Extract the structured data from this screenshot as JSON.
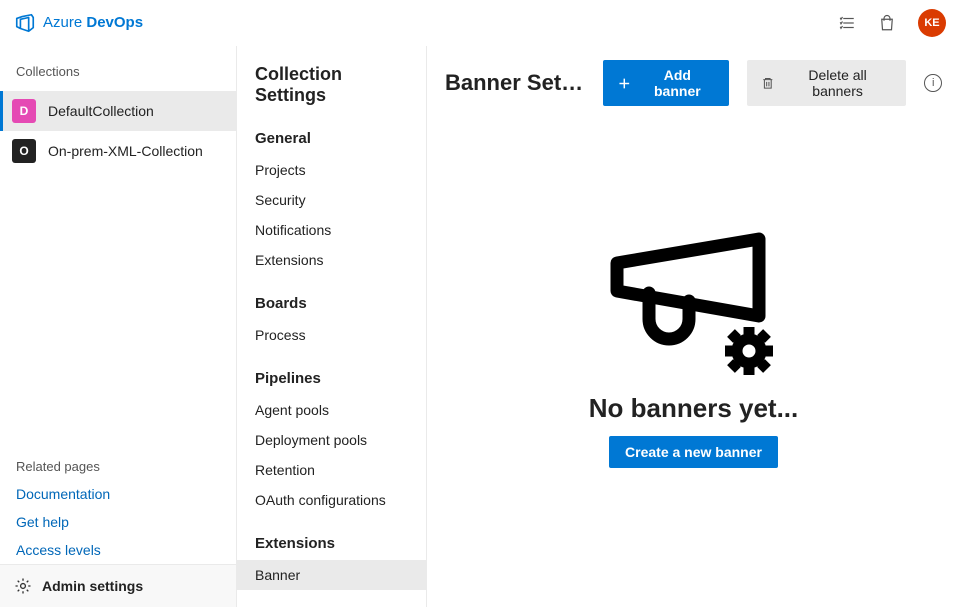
{
  "header": {
    "brand_prefix": "Azure ",
    "brand_bold": "DevOps",
    "avatar_initials": "KE"
  },
  "collections": {
    "title": "Collections",
    "items": [
      {
        "initial": "D",
        "label": "DefaultCollection",
        "color": "pink",
        "selected": true
      },
      {
        "initial": "O",
        "label": "On-prem-XML-Collection",
        "color": "dark",
        "selected": false
      }
    ],
    "related_title": "Related pages",
    "related_links": [
      "Documentation",
      "Get help",
      "Access levels"
    ],
    "admin_label": "Admin settings"
  },
  "settings_nav": {
    "title": "Collection Settings",
    "groups": [
      {
        "label": "General",
        "items": [
          "Projects",
          "Security",
          "Notifications",
          "Extensions"
        ]
      },
      {
        "label": "Boards",
        "items": [
          "Process"
        ]
      },
      {
        "label": "Pipelines",
        "items": [
          "Agent pools",
          "Deployment pools",
          "Retention",
          "OAuth configurations"
        ]
      },
      {
        "label": "Extensions",
        "items": [
          "Banner"
        ],
        "active_index": 0
      }
    ]
  },
  "content": {
    "title": "Banner Sett…",
    "add_button": "Add banner",
    "delete_button": "Delete all banners",
    "empty_title": "No banners yet...",
    "create_button": "Create a new banner"
  }
}
